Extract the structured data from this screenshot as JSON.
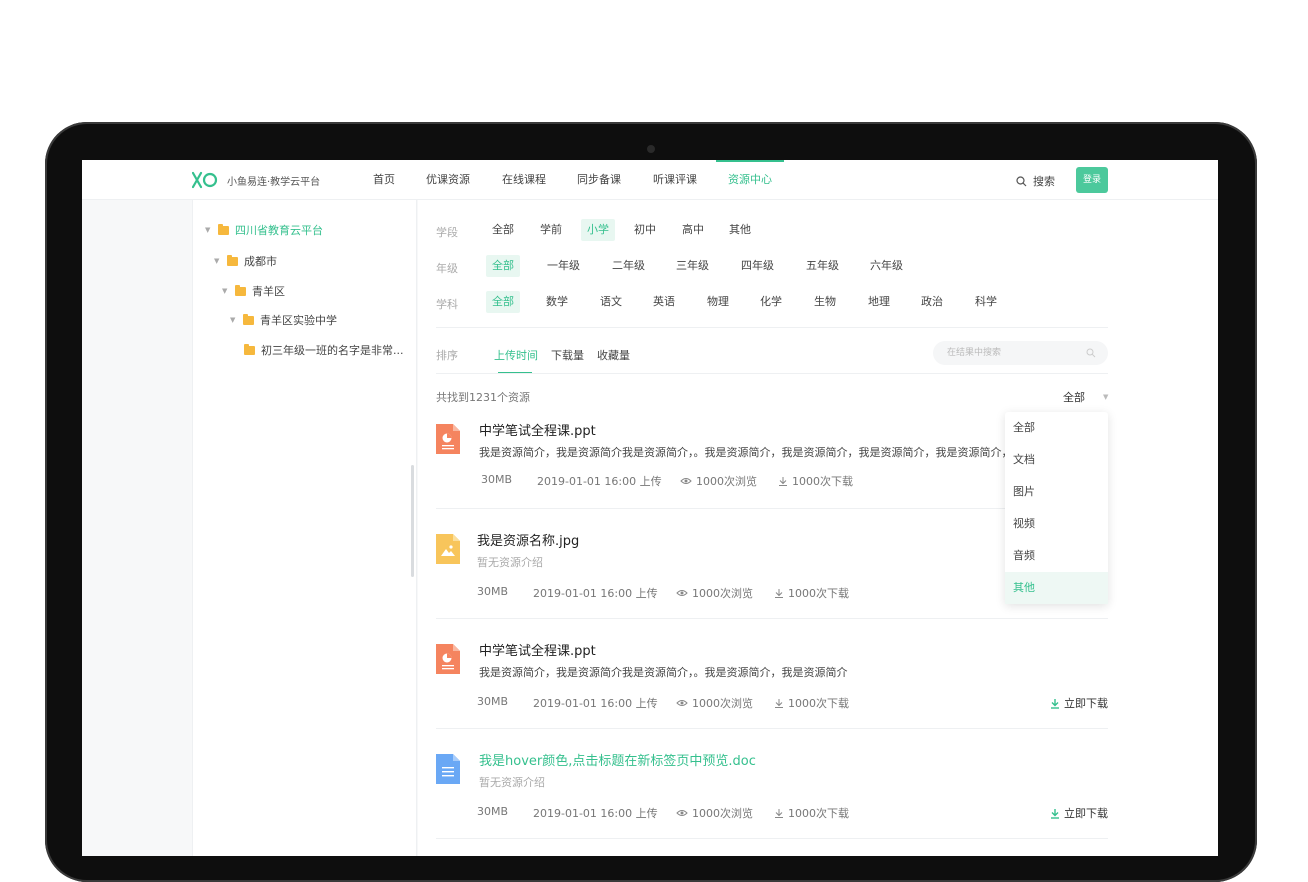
{
  "brand": {
    "name": "小鱼易连·教学云平台"
  },
  "nav": {
    "items": [
      "首页",
      "优课资源",
      "在线课程",
      "同步备课",
      "听课评课",
      "资源中心"
    ],
    "active": 5,
    "search": "搜索",
    "login": "登录"
  },
  "tree": {
    "nodes": [
      {
        "label": "四川省教育云平台"
      },
      {
        "label": "成都市"
      },
      {
        "label": "青羊区"
      },
      {
        "label": "青羊区实验中学"
      },
      {
        "label": "初三年级一班的名字是非常..."
      }
    ]
  },
  "filters": {
    "stage": {
      "label": "学段",
      "options": [
        "全部",
        "学前",
        "小学",
        "初中",
        "高中",
        "其他"
      ],
      "active": 2
    },
    "grade": {
      "label": "年级",
      "options": [
        "全部",
        "一年级",
        "二年级",
        "三年级",
        "四年级",
        "五年级",
        "六年级"
      ],
      "active": 0
    },
    "subject": {
      "label": "学科",
      "options": [
        "全部",
        "数学",
        "语文",
        "英语",
        "物理",
        "化学",
        "生物",
        "地理",
        "政治",
        "科学"
      ],
      "active": 0
    }
  },
  "sort": {
    "label": "排序",
    "options": [
      "上传时间",
      "下载量",
      "收藏量"
    ],
    "active": 0,
    "search_placeholder": "在结果中搜索"
  },
  "results": {
    "count_text": "共找到1231个资源",
    "type_select": "全部",
    "dropdown": {
      "options": [
        "全部",
        "文档",
        "图片",
        "视频",
        "音频",
        "其他"
      ],
      "highlighted": 5
    },
    "items": [
      {
        "icon": "ppt-file-icon",
        "color": "#f5845f",
        "title": "中学笔试全程课.ppt",
        "desc": "我是资源简介，我是资源简介我是资源简介，。我是资源简介，我是资源简介，我是资源简介，我是资源简介，我是资源简介",
        "size": "30MB",
        "uploaded": "2019-01-01 16:00 上传",
        "views": "1000次浏览",
        "downloads": "1000次下载",
        "download_btn": ""
      },
      {
        "icon": "image-file-icon",
        "color": "#f8c55b",
        "title": "我是资源名称.jpg",
        "desc": "暂无资源介绍",
        "size": "30MB",
        "uploaded": "2019-01-01 16:00 上传",
        "views": "1000次浏览",
        "downloads": "1000次下载",
        "download_btn": ""
      },
      {
        "icon": "ppt-file-icon",
        "color": "#f5845f",
        "title": "中学笔试全程课.ppt",
        "desc": "我是资源简介，我是资源简介我是资源简介，。我是资源简介，我是资源简介",
        "size": "30MB",
        "uploaded": "2019-01-01 16:00 上传",
        "views": "1000次浏览",
        "downloads": "1000次下载",
        "download_btn": "立即下载"
      },
      {
        "icon": "doc-file-icon",
        "color": "#6aa8f5",
        "title": "我是hover颜色,点击标题在新标签页中预览.doc",
        "desc": "暂无资源介绍",
        "size": "30MB",
        "uploaded": "2019-01-01 16:00 上传",
        "views": "1000次浏览",
        "downloads": "1000次下载",
        "download_btn": "立即下载"
      }
    ]
  },
  "colors": {
    "accent": "#35c08e",
    "folder": "#f6b83d"
  }
}
